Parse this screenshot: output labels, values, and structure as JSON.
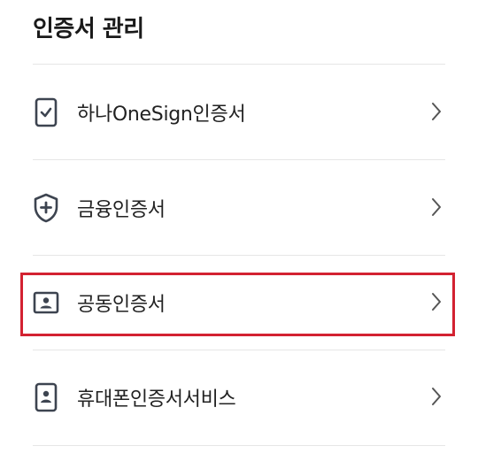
{
  "header": {
    "title": "인증서 관리"
  },
  "items": [
    {
      "label": "하나OneSign인증서",
      "icon": "phone-check-icon"
    },
    {
      "label": "금융인증서",
      "icon": "shield-plus-icon"
    },
    {
      "label": "공동인증서",
      "icon": "id-card-icon"
    },
    {
      "label": "휴대폰인증서서비스",
      "icon": "phone-person-icon"
    }
  ],
  "colors": {
    "highlight": "#d32231",
    "icon": "#3d4450",
    "divider": "#e6e6e6"
  }
}
